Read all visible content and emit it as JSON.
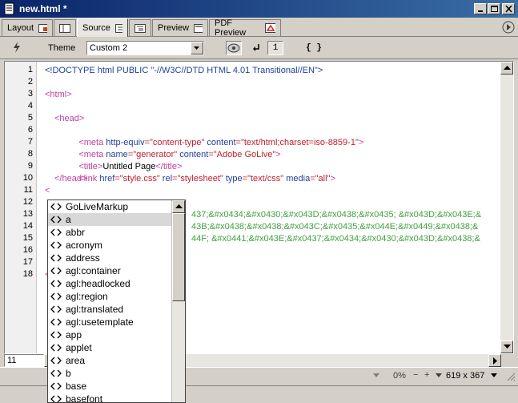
{
  "window": {
    "title": "new.html *"
  },
  "tabs": [
    {
      "label": "Layout"
    },
    {
      "label": ""
    },
    {
      "label": "Source"
    },
    {
      "label": ""
    },
    {
      "label": "Preview"
    },
    {
      "label": "PDF Preview"
    }
  ],
  "toolbar": {
    "theme_label": "Theme",
    "theme_value": "Custom 2",
    "line_number_toggle": "1",
    "braces_label": "{ }"
  },
  "editor": {
    "line_numbers": [
      "1",
      "2",
      "3",
      "4",
      "5",
      "6",
      "7",
      "8",
      "9",
      "10",
      "11",
      "12",
      "13",
      "14",
      "15",
      "16",
      "17",
      "18"
    ],
    "line1": {
      "text": "<!DOCTYPE html PUBLIC \"-//W3C//DTD HTML 4.01 Transitional//EN\">"
    },
    "line3": {
      "text": "<html>"
    },
    "line5": {
      "text": "<head>"
    },
    "line6": {
      "tag": "<meta ",
      "a1": "http-equiv",
      "v1": "=\"content-type\"",
      "a2": " content",
      "v2": "=\"text/html;charset=iso-8859-1\"",
      "close": ">"
    },
    "line7": {
      "tag": "<meta ",
      "a1": "name",
      "v1": "=\"generator\"",
      "a2": " content",
      "v2": "=\"Adobe GoLive\"",
      "close": ">"
    },
    "line8": {
      "open": "<title>",
      "text": "Untitled Page",
      "close": "</title>"
    },
    "line9": {
      "tag": "<link ",
      "a1": "href",
      "v1": "=\"style.css\"",
      "a2": " rel",
      "v2": "=\"stylesheet\"",
      "a3": " type",
      "v3": "=\"text/css\"",
      "a4": " media",
      "v4": "=\"all\"",
      "close": ">"
    },
    "line10": {
      "text": "</head>"
    },
    "line11": {
      "text": "<"
    },
    "line13": {
      "text": "437;&#x0434;&#x0430;&#x043D;&#x0438;&#x0435; &#x043D;&#x043E;&"
    },
    "line14": {
      "text": "43B;&#x0438;&#x0438;&#x043C;&#x0435;&#x044E;&#x0449;&#x0438;&"
    },
    "line15": {
      "text": "44F; &#x0441;&#x043E;&#x0437;&#x0434;&#x0430;&#x043D;&#x0438;&"
    },
    "line18": {
      "text": "<"
    }
  },
  "autocomplete": {
    "items": [
      "GoLiveMarkup",
      "a",
      "abbr",
      "acronym",
      "address",
      "agl:container",
      "agl:headlocked",
      "agl:region",
      "agl:translated",
      "agl:usetemplate",
      "app",
      "applet",
      "area",
      "b",
      "base",
      "basefont"
    ],
    "selected": "a"
  },
  "status": {
    "line_field": "11",
    "zoom": "0%",
    "dimensions": "619 x 367"
  },
  "colors": {
    "titlebar_start": "#0a246a",
    "tag_color": "#c040a0",
    "attr_color": "#2040a0",
    "value_color": "#c0202c",
    "entity_color": "#40a040"
  }
}
